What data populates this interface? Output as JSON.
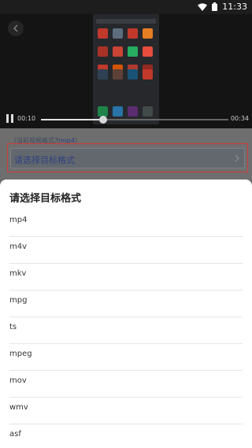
{
  "status_bar": {
    "time": "11:33"
  },
  "player": {
    "current_time": "00:10",
    "total_time": "00:34",
    "progress": 0.33
  },
  "form": {
    "current_format_prefix": "（当前视频格式为",
    "current_format_value": "mp4",
    "current_format_suffix": "）",
    "select_label": "请选择目标格式"
  },
  "sheet": {
    "title": "请选择目标格式",
    "options": [
      "mp4",
      "m4v",
      "mkv",
      "mpg",
      "ts",
      "mpeg",
      "mov",
      "wmv",
      "asf"
    ]
  },
  "colors": {
    "highlight_border": "#d23a3a",
    "accent_text": "#2f3f80"
  }
}
